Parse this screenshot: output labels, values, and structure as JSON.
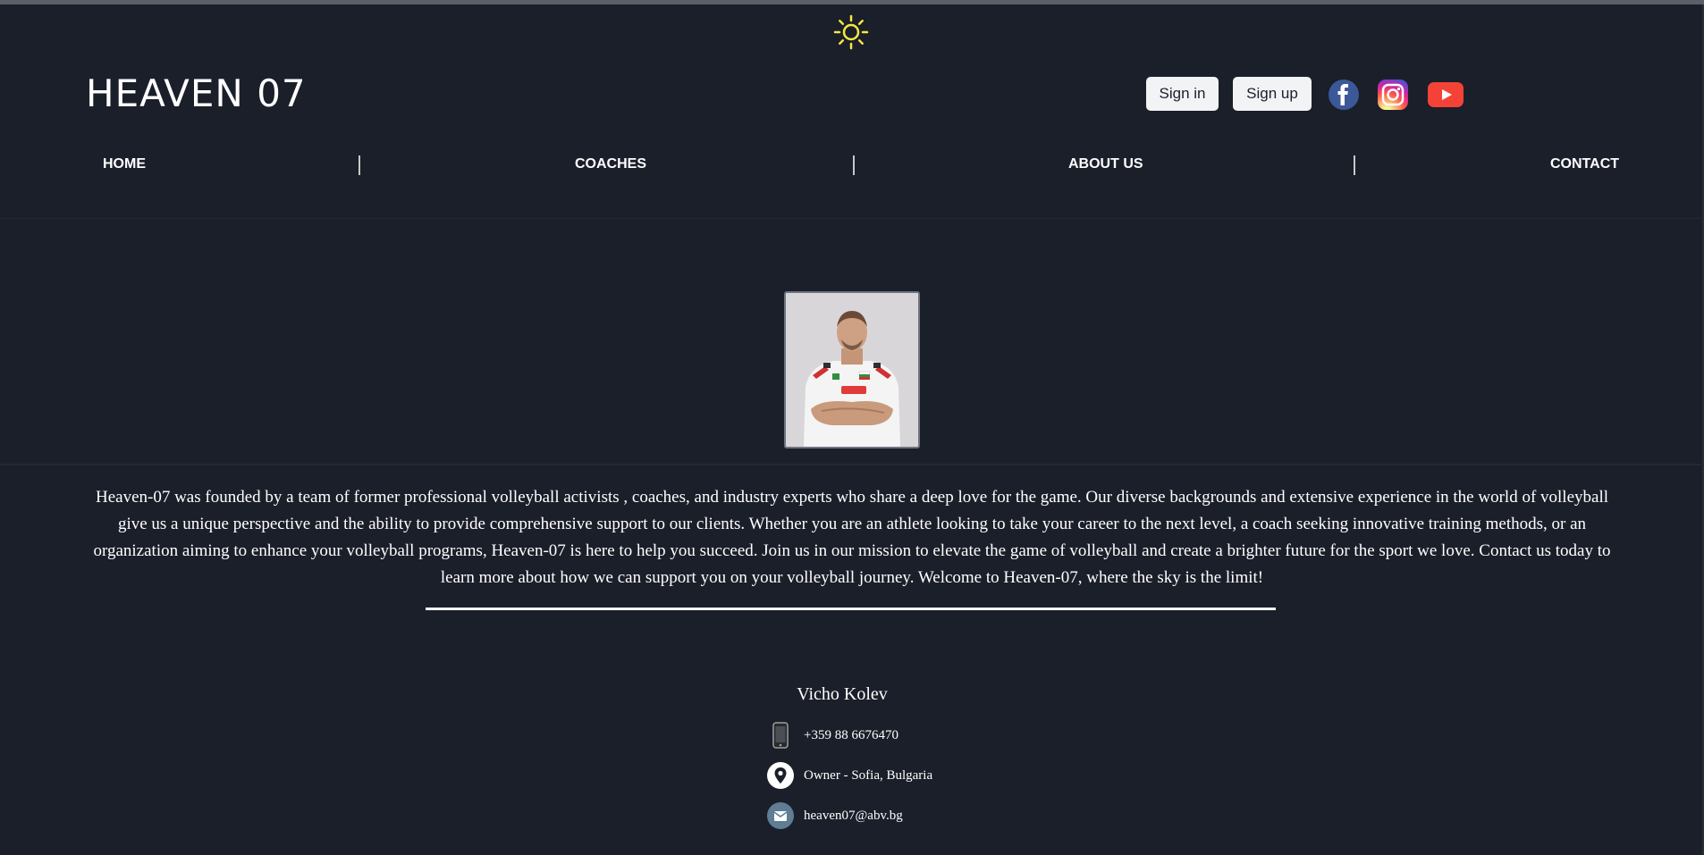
{
  "theme_toggle": {
    "icon": "sun-icon",
    "color": "#f5e642"
  },
  "header": {
    "logo": "HEAVEN 07",
    "sign_in_label": "Sign in",
    "sign_up_label": "Sign up",
    "social": [
      {
        "icon": "facebook-icon",
        "color": "#3b5998"
      },
      {
        "icon": "instagram-icon",
        "color": "#d6249f"
      },
      {
        "icon": "youtube-icon",
        "color": "#f44336"
      }
    ]
  },
  "nav": {
    "items": [
      {
        "label": "HOME"
      },
      {
        "label": "COACHES"
      },
      {
        "label": "ABOUT US"
      },
      {
        "label": "CONTACT"
      }
    ]
  },
  "about": {
    "photo": "coach-photo",
    "text": "Heaven-07 was founded by a team of former professional volleyball activists , coaches, and industry experts who share a deep love for the game. Our diverse backgrounds and extensive experience in the world of volleyball give us a unique perspective and the ability to provide comprehensive support to our clients. Whether you are an athlete looking to take your career to the next level, a coach seeking innovative training methods, or an organization aiming to enhance your volleyball programs, Heaven-07 is here to help you succeed. Join us in our mission to elevate the game of volleyball and create a brighter future for the sport we love. Contact us today to learn more about how we can support you on your volleyball journey. Welcome to Heaven-07, where the sky is the limit!"
  },
  "contact": {
    "name": "Vicho Kolev",
    "phone": "+359 88 6676470",
    "location": "Owner - Sofia, Bulgaria",
    "email": "heaven07@abv.bg"
  },
  "colors": {
    "background": "#1b1f2a",
    "text": "#ffffff",
    "button_bg": "#f1f3f5"
  }
}
